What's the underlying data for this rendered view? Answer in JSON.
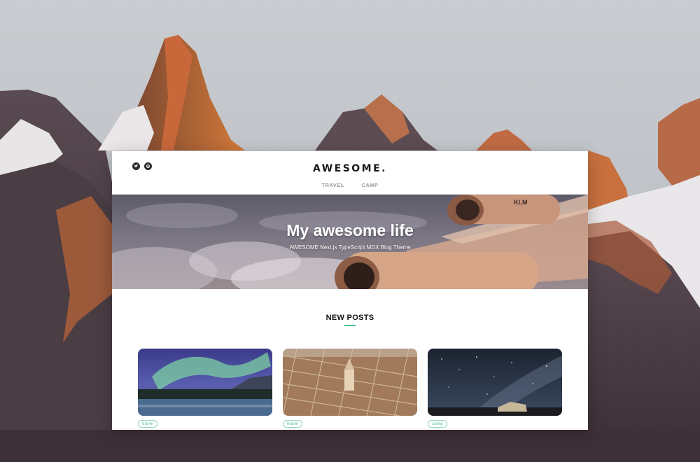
{
  "site": {
    "logo": "AWESOME.",
    "nav": [
      "TRAVEL",
      "CAMP"
    ],
    "social": {
      "twitter_icon": "twitter-icon",
      "github_icon": "github-icon"
    }
  },
  "hero": {
    "title": "My awesome life",
    "subtitle": "AWESOME Next.js TypeScript MDX Blog Theme",
    "airline_mark": "KLM"
  },
  "section": {
    "title": "NEW POSTS"
  },
  "posts": [
    {
      "image": "aurora-lake",
      "tag": "travel"
    },
    {
      "image": "city-aerial",
      "tag": "travel"
    },
    {
      "image": "starry-night",
      "tag": "camp"
    }
  ],
  "colors": {
    "accent": "#4fbf8a",
    "tag_text": "#5cbf92"
  }
}
